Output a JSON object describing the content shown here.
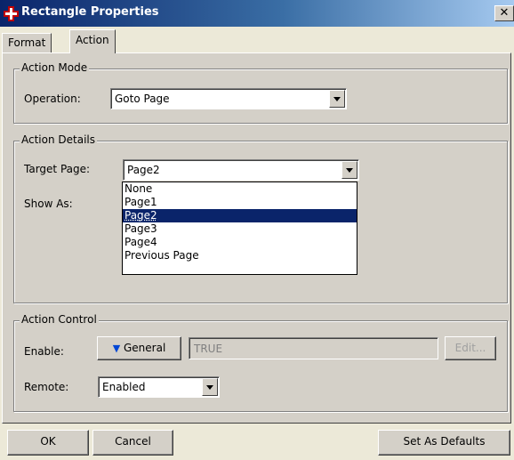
{
  "window": {
    "title": "Rectangle Properties",
    "close_glyph": "✕"
  },
  "tabs": [
    {
      "label": "Format"
    },
    {
      "label": "Action"
    }
  ],
  "action_mode": {
    "legend": "Action Mode",
    "operation_label": "Operation:",
    "operation_value": "Goto Page"
  },
  "action_details": {
    "legend": "Action Details",
    "target_page_label": "Target Page:",
    "target_page_value": "Page2",
    "show_as_label": "Show As:",
    "options": [
      "None",
      "Page1",
      "Page2",
      "Page3",
      "Page4",
      "Previous Page"
    ]
  },
  "action_control": {
    "legend": "Action Control",
    "enable_label": "Enable:",
    "general_label": "General",
    "enable_value": "TRUE",
    "edit_label": "Edit...",
    "remote_label": "Remote:",
    "remote_value": "Enabled"
  },
  "footer": {
    "ok": "OK",
    "cancel": "Cancel",
    "set_defaults": "Set As Defaults"
  },
  "colors": {
    "title_bar": "#0a246a",
    "selection": "#0a246a",
    "general_arrow": "#0046d5"
  }
}
